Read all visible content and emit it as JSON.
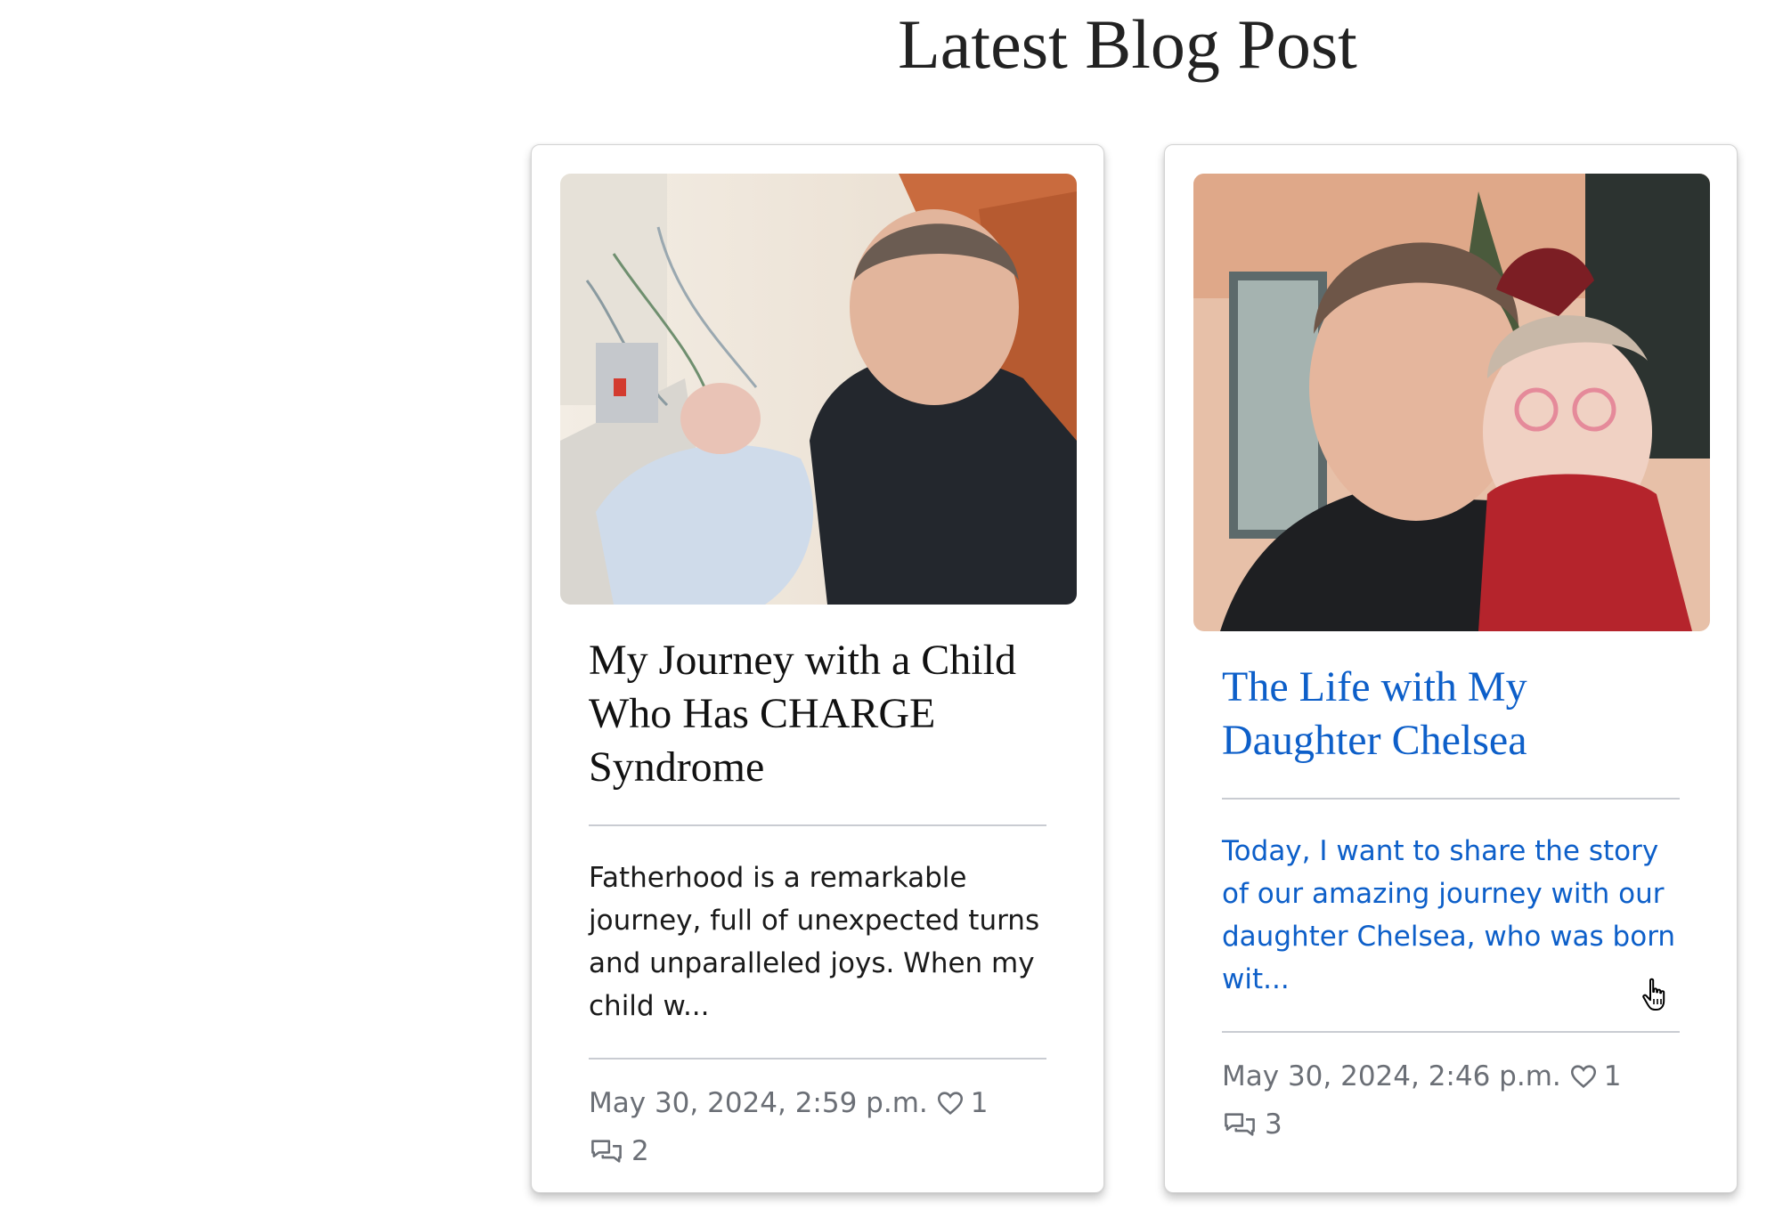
{
  "section": {
    "title": "Latest Blog Post"
  },
  "posts": [
    {
      "title": "My Journey with a Child Who Has CHARGE Syndrome",
      "excerpt": "Fatherhood is a remarkable journey, full of unexpected turns and unparalleled joys. When my child w...",
      "date": "May 30, 2024, 2:59 p.m.",
      "likes": "1",
      "comments": "2",
      "image_icon": "photo-father-holding-newborn-in-hospital"
    },
    {
      "title": "The Life with My Daughter Chelsea",
      "excerpt": "Today, I want to share the story of our amazing journey with our daughter Chelsea, who was born wit...",
      "date": "May 30, 2024, 2:46 p.m.",
      "likes": "1",
      "comments": "3",
      "image_icon": "photo-mother-and-daughter-selfie"
    }
  ],
  "colors": {
    "hover_link": "#0d5fc9",
    "meta_text": "#6b6f76",
    "title_text": "#222222"
  }
}
